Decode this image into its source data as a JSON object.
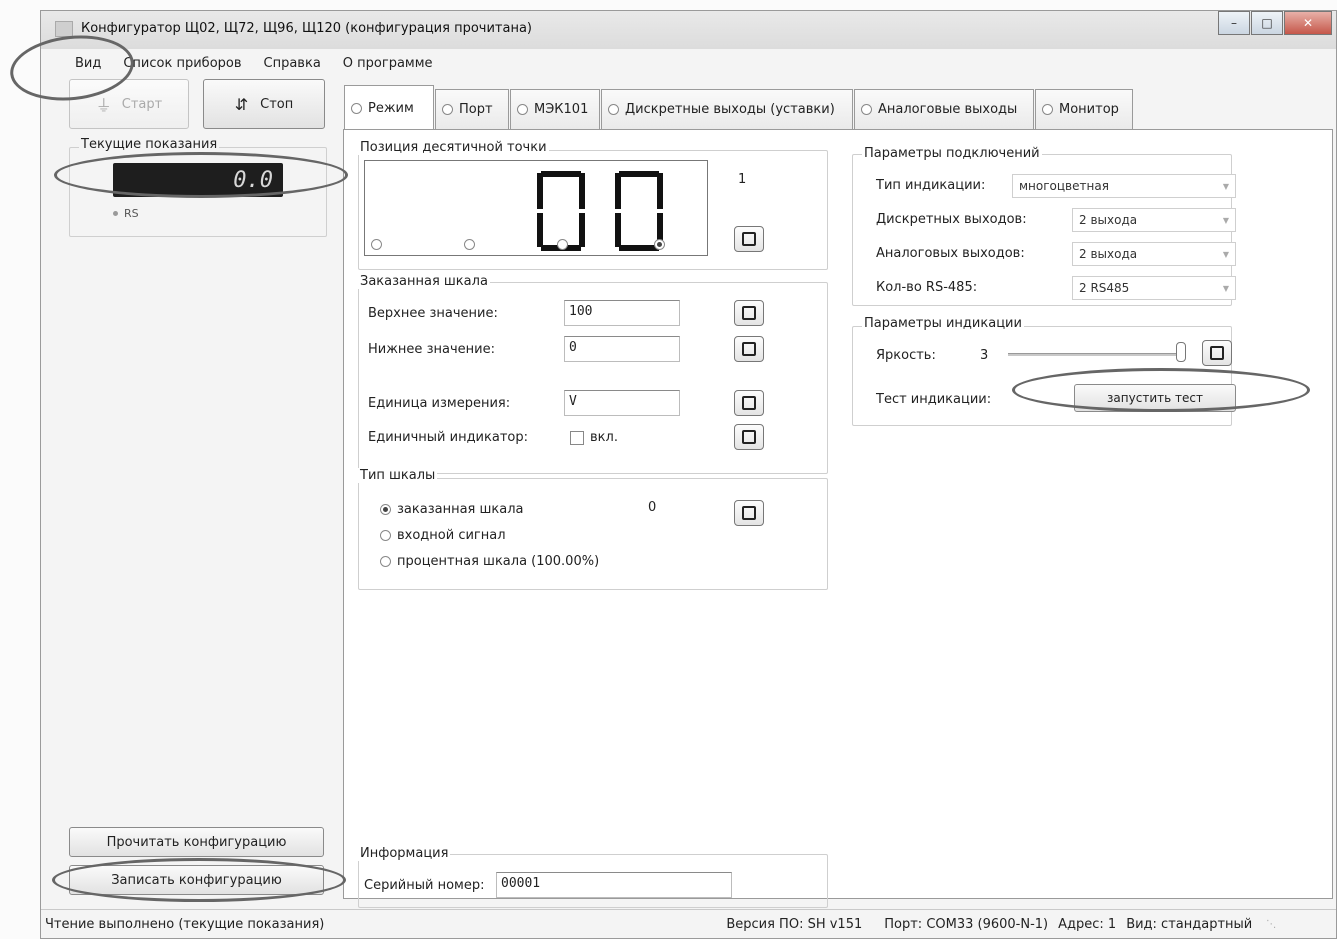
{
  "window": {
    "title": "Конфигуратор Щ02, Щ72, Щ96, Щ120 (конфигурация прочитана)",
    "controls": [
      "minimize-icon",
      "maximize-icon",
      "close-icon"
    ]
  },
  "menu": {
    "items": [
      "Вид",
      "Список приборов",
      "Справка",
      "О программе"
    ]
  },
  "left": {
    "start_label": "Старт",
    "stop_label": "Стоп",
    "readings_title": "Текущие показания",
    "lcd_value": "0.0",
    "rs_label": "RS",
    "read_config": "Прочитать конфигурацию",
    "write_config": "Записать конфигурацию"
  },
  "tabs": [
    {
      "label": "Режим",
      "active": true
    },
    {
      "label": "Порт",
      "active": false
    },
    {
      "label": "МЭК101",
      "active": false
    },
    {
      "label": "Дискретные выходы (уставки)",
      "active": false
    },
    {
      "label": "Аналоговые выходы",
      "active": false
    },
    {
      "label": "Монитор",
      "active": false
    }
  ],
  "mode": {
    "decimal_title": "Позиция десятичной точки",
    "decimal_value": "1",
    "display_digits": "0.0",
    "scale_title": "Заказанная шкала",
    "upper_label": "Верхнее значение:",
    "upper_value": "100",
    "lower_label": "Нижнее значение:",
    "lower_value": "0",
    "unit_label": "Единица измерения:",
    "unit_value": "V",
    "single_label": "Единичный индикатор:",
    "single_checkbox": "вкл.",
    "scale_type_title": "Тип шкалы",
    "scale_options": [
      "заказанная шкала",
      "входной сигнал",
      "процентная шкала (100.00%)"
    ],
    "scale_type_value": "0",
    "info_title": "Информация",
    "serial_label": "Серийный номер:",
    "serial_value": "00001"
  },
  "connection": {
    "title": "Параметры подключений",
    "indication_type_label": "Тип индикации:",
    "indication_type_value": "многоцветная",
    "discrete_label": "Дискретных выходов:",
    "discrete_value": "2 выхода",
    "analog_label": "Аналоговых выходов:",
    "analog_value": "2 выхода",
    "rs_label": "Кол-во RS-485:",
    "rs_value": "2 RS485"
  },
  "indication": {
    "title": "Параметры индикации",
    "brightness_label": "Яркость:",
    "brightness_value": "3",
    "test_label": "Тест индикации:",
    "test_button": "запустить тест"
  },
  "status": {
    "left": "Чтение выполнено (текущие показания)",
    "version": "Версия ПО: SH v151",
    "port": "Порт: COM33 (9600-N-1)",
    "address": "Адрес: 1",
    "view": "Вид: стандартный"
  }
}
